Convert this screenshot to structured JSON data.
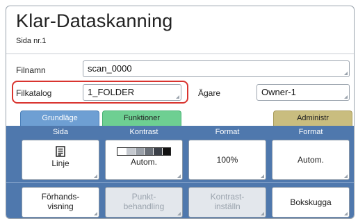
{
  "header": {
    "title": "Klar-Dataskanning",
    "page_label": "Sida nr.1"
  },
  "form": {
    "filename_label": "Filnamn",
    "filename_value": "scan_0000",
    "folder_label": "Filkatalog",
    "folder_value": "1_FOLDER",
    "owner_label": "Ägare",
    "owner_value": "Owner-1"
  },
  "tabs": [
    {
      "label": "Grundläge"
    },
    {
      "label": "Funktioner"
    },
    {
      "label": "Administr"
    }
  ],
  "columns": [
    "Sida",
    "Kontrast",
    "Format",
    "Format"
  ],
  "row1": [
    {
      "label": "Linje",
      "icon": "document-lines-icon"
    },
    {
      "label": "Autom.",
      "icon": "contrast-scale-icon"
    },
    {
      "label": "100%"
    },
    {
      "label": "Autom."
    }
  ],
  "row2": [
    {
      "label_line1": "Förhands-",
      "label_line2": "visning",
      "enabled": true
    },
    {
      "label_line1": "Punkt-",
      "label_line2": "behandling",
      "enabled": false
    },
    {
      "label_line1": "Kontrast-",
      "label_line2": "inställn",
      "enabled": false
    },
    {
      "label_line1": "Bokskugga",
      "label_line2": "",
      "enabled": true
    }
  ],
  "colors": {
    "accent_highlight": "#d9342f",
    "tab_basic": "#6e9fd3",
    "tab_functions": "#6ecf92",
    "tab_admin": "#c9bd7f",
    "panel": "#4f78ad"
  }
}
